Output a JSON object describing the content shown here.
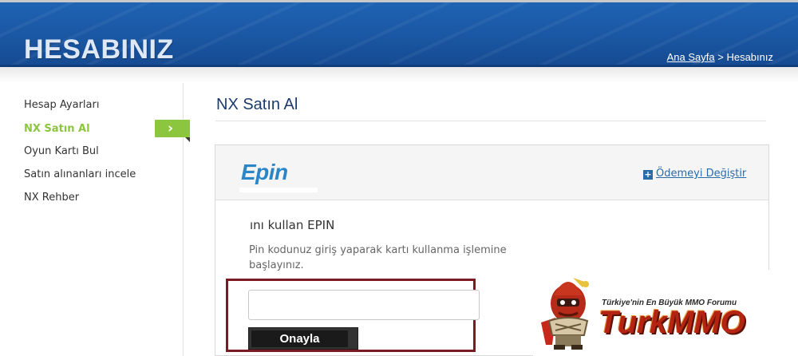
{
  "header": {
    "title": "HESABINIZ",
    "breadcrumb": {
      "home_label": "Ana Sayfa",
      "separator": ">",
      "current": "Hesabınız"
    },
    "colors": {
      "bar": "#1a56a2",
      "title_text": "#dfe9f6"
    }
  },
  "sidebar": {
    "items": [
      {
        "label": "Hesap Ayarları",
        "active": false
      },
      {
        "label": "NX Satın Al",
        "active": true
      },
      {
        "label": "Oyun Kartı Bul",
        "active": false
      },
      {
        "label": "Satın alınanları incele",
        "active": false
      },
      {
        "label": "NX Rehber",
        "active": false
      }
    ],
    "active_indicator_icon": "chevron-right-icon",
    "active_color": "#8cc63f"
  },
  "main": {
    "page_title": "NX Satın Al",
    "payment": {
      "method_logo_text": "Epin",
      "change_icon": "plus-icon",
      "change_label": "Ödemeyi Değiştir"
    },
    "pin_section": {
      "title": "ını kullan EPIN",
      "description": "Pin kodunuz giriş yaparak kartı kullanma işlemine başlayınız.",
      "pin_input_value": "",
      "confirm_label": "Onayla",
      "highlight_color": "#7b1a22"
    }
  },
  "watermark": {
    "tagline": "Türkiye'nin En Büyük MMO Forumu",
    "logo_text": "TurkMMO"
  }
}
